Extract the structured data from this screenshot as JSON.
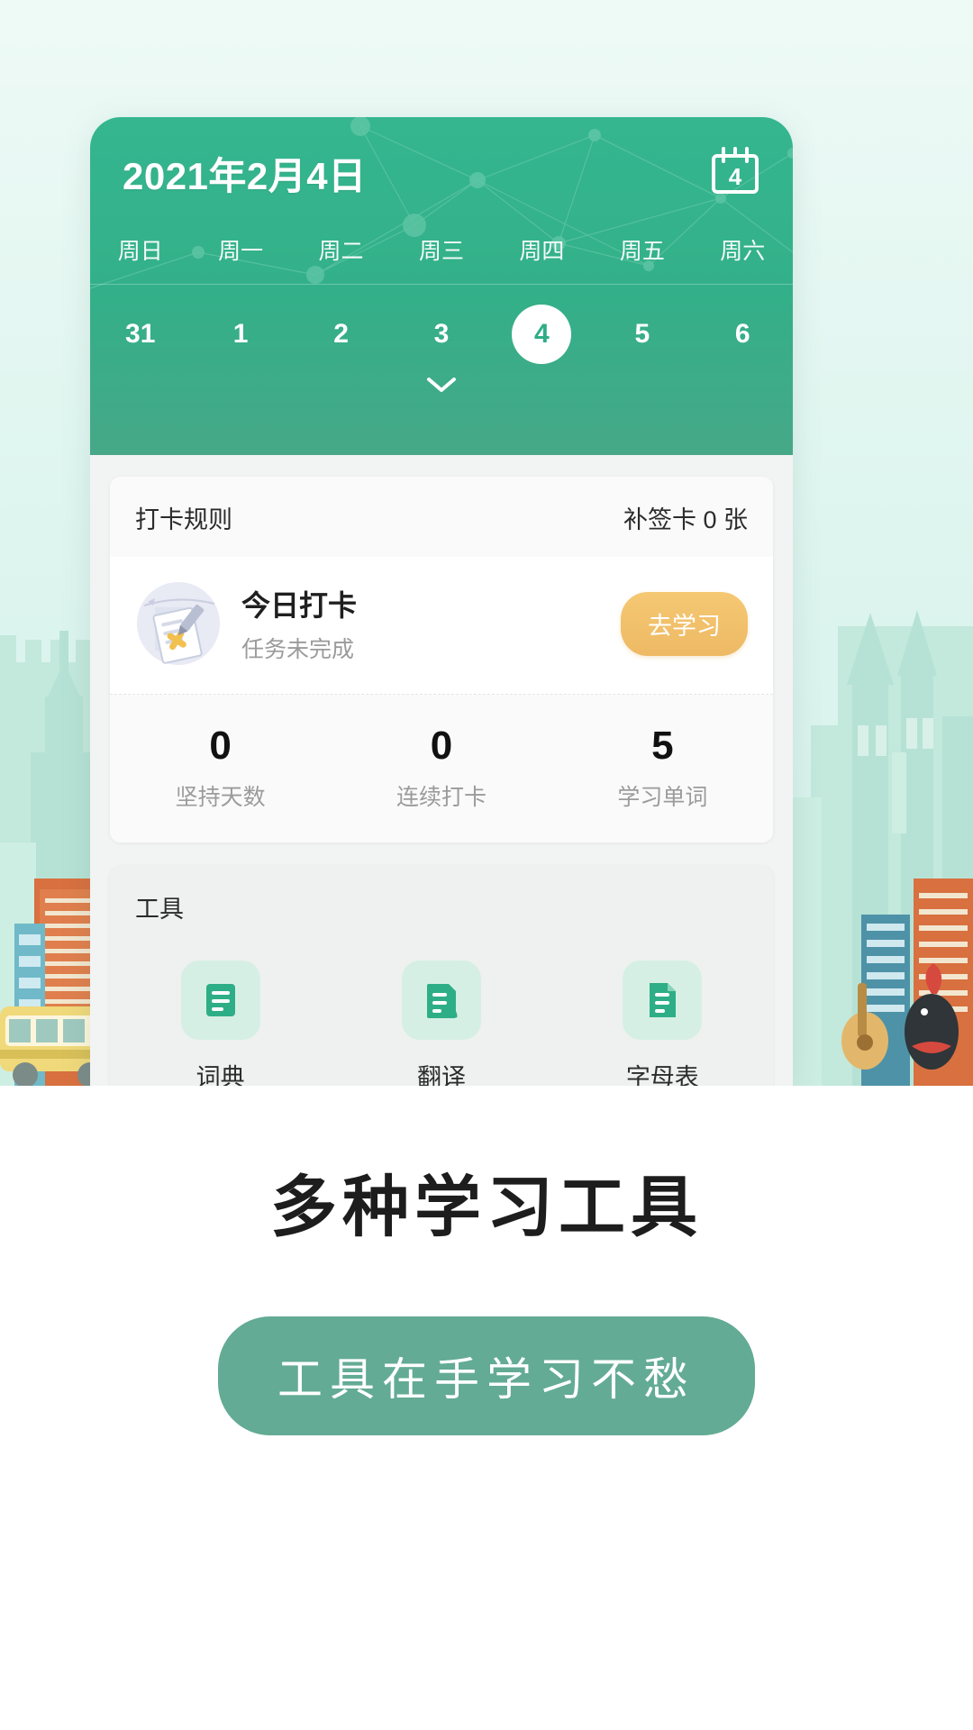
{
  "app": {
    "header": {
      "date_title": "2021年2月4日",
      "calendar_icon_day": "4",
      "calendar_icon_name": "calendar-icon",
      "expand_icon_name": "chevron-down-icon",
      "weekdays": [
        "周日",
        "周一",
        "周二",
        "周三",
        "周四",
        "周五",
        "周六"
      ],
      "dates": [
        {
          "label": "31",
          "selected": false
        },
        {
          "label": "1",
          "selected": false
        },
        {
          "label": "2",
          "selected": false
        },
        {
          "label": "3",
          "selected": false
        },
        {
          "label": "4",
          "selected": true
        },
        {
          "label": "5",
          "selected": false
        },
        {
          "label": "6",
          "selected": false
        }
      ],
      "bg_color": "#33b089"
    },
    "checkin_card": {
      "rules_label": "打卡规则",
      "makeup_cards_label": "补签卡 0 张",
      "task_title": "今日打卡",
      "task_status": "任务未完成",
      "task_icon_name": "checklist-incomplete-illustration",
      "action_button": "去学习",
      "action_button_color": "#eeb964",
      "stats": [
        {
          "value": "0",
          "label": "坚持天数"
        },
        {
          "value": "0",
          "label": "连续打卡"
        },
        {
          "value": "5",
          "label": "学习单词"
        }
      ]
    },
    "tools_card": {
      "title": "工具",
      "items": [
        {
          "label": "词典",
          "icon": "dictionary-book-icon"
        },
        {
          "label": "翻译",
          "icon": "translate-document-icon"
        },
        {
          "label": "字母表",
          "icon": "alphabet-list-icon"
        }
      ],
      "icon_color": "#2eae86"
    }
  },
  "promo": {
    "headline": "多种学习工具",
    "subtitle": "工具在手学习不愁",
    "pill_color": "#63ab94"
  }
}
